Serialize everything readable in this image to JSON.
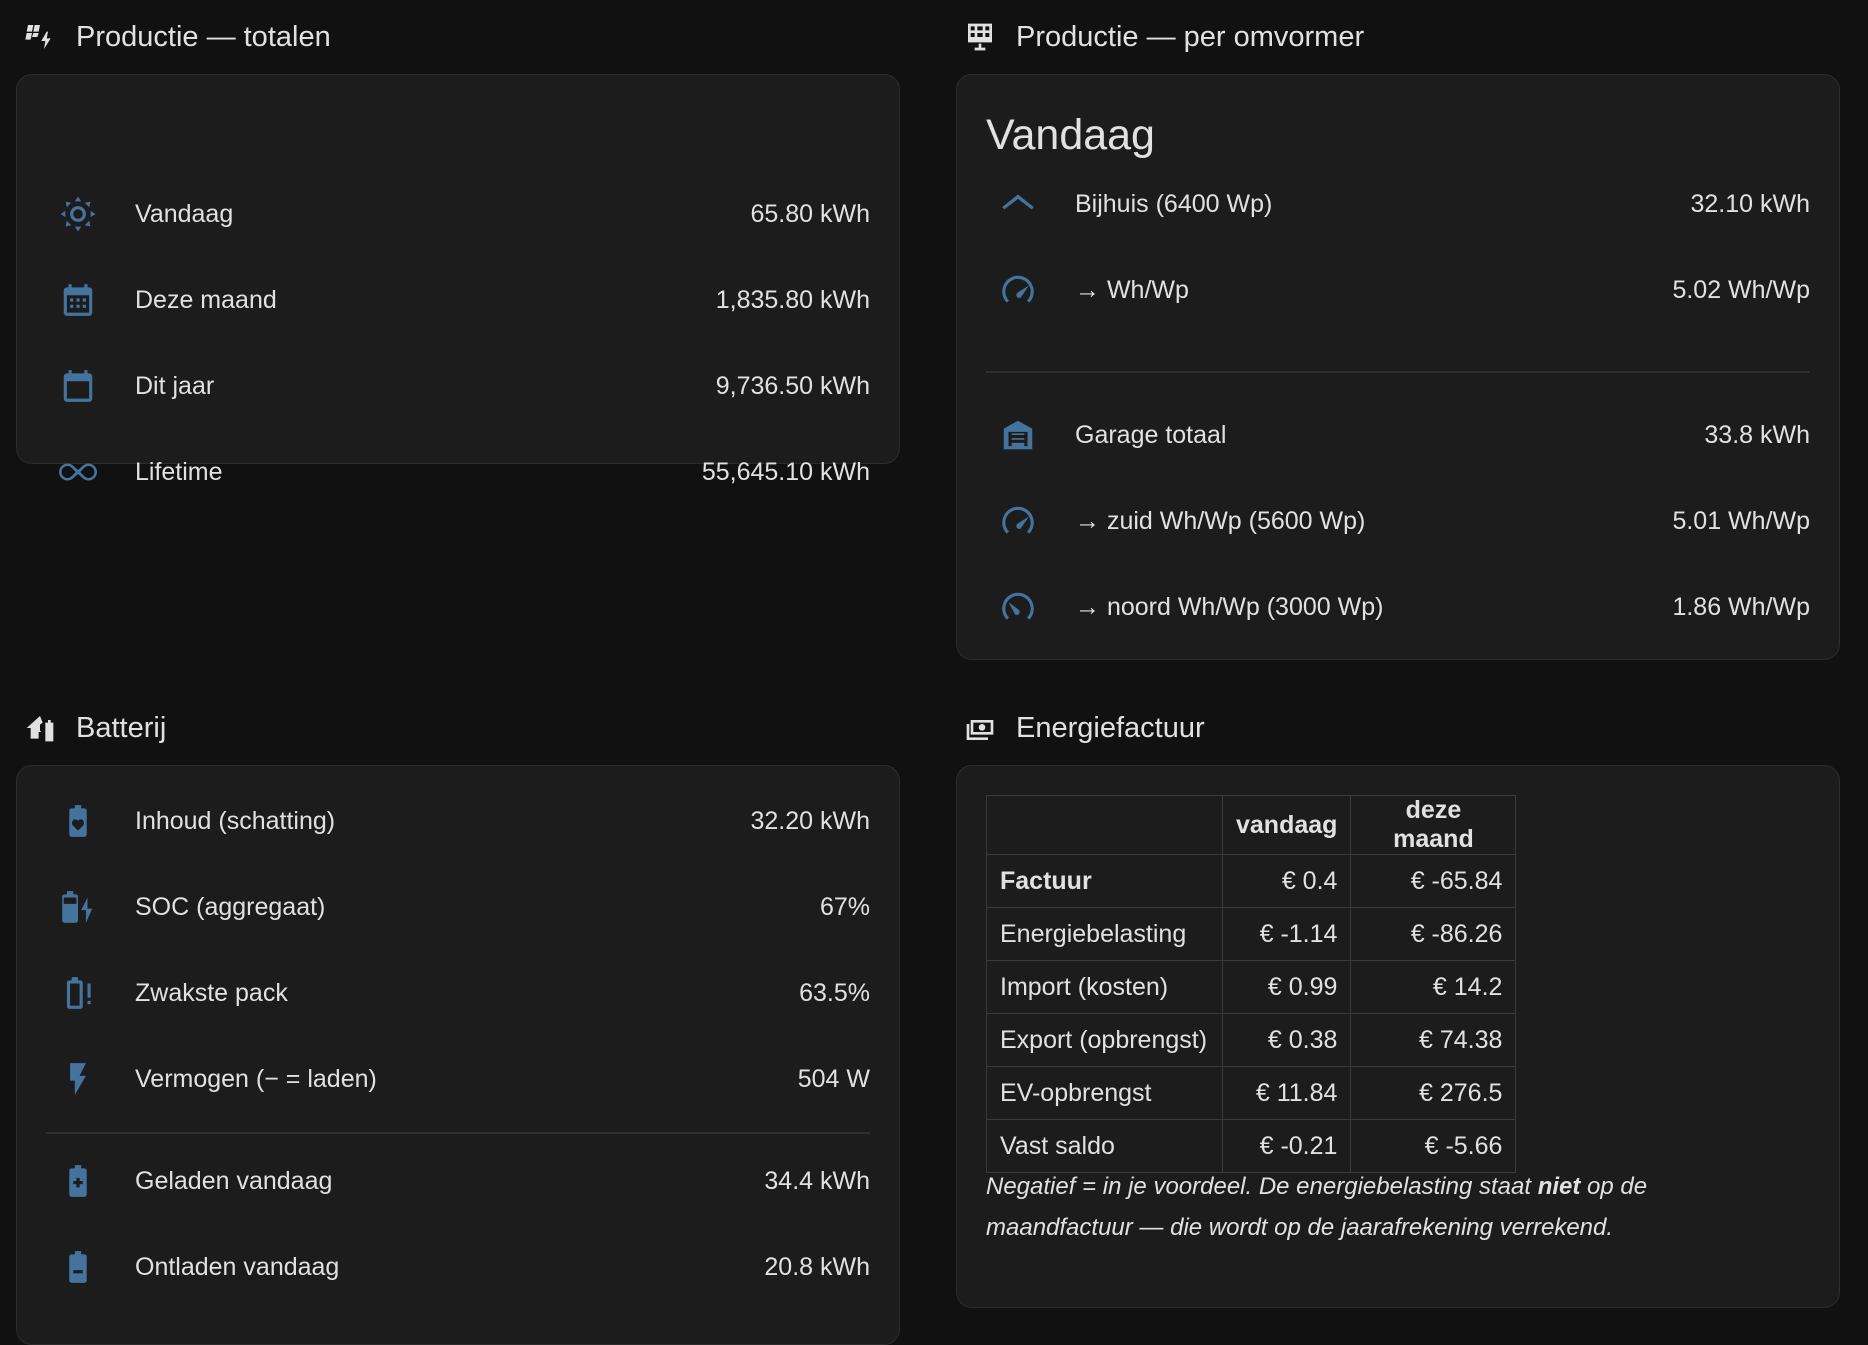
{
  "colors": {
    "background": "#111111",
    "card": "#1c1c1c",
    "icon": "#44739e",
    "text": "#e1e1e1"
  },
  "totals": {
    "title": "Productie — totalen",
    "title_icon": "solar-power-icon",
    "rows": [
      {
        "icon": "sun-icon",
        "label": "Vandaag",
        "value": "65.80 kWh"
      },
      {
        "icon": "calendar-month-icon",
        "label": "Deze maand",
        "value": "1,835.80 kWh"
      },
      {
        "icon": "calendar-blank-icon",
        "label": "Dit jaar",
        "value": "9,736.50 kWh"
      },
      {
        "icon": "infinity-icon",
        "label": "Lifetime",
        "value": "55,645.10 kWh"
      }
    ]
  },
  "inverter": {
    "title": "Productie — per omvormer",
    "title_icon": "solar-panel-icon",
    "card_title": "Vandaag",
    "rows": [
      {
        "icon": "roof-icon",
        "label": "Bijhuis (6400 Wp)",
        "value": "32.10 kWh"
      },
      {
        "icon": "gauge-icon",
        "label": "→ Wh/Wp",
        "value": "5.02 Wh/Wp"
      },
      {
        "icon": "garage-icon",
        "label": "Garage totaal",
        "value": "33.8 kWh"
      },
      {
        "icon": "gauge-icon",
        "label": "→ zuid Wh/Wp (5600 Wp)",
        "value": "5.01 Wh/Wp"
      },
      {
        "icon": "gauge-low-icon",
        "label": "→ noord Wh/Wp (3000 Wp)",
        "value": "1.86 Wh/Wp"
      }
    ]
  },
  "battery": {
    "title": "Batterij",
    "title_icon": "home-battery-icon",
    "rows": [
      {
        "icon": "battery-heart-icon",
        "label": "Inhoud (schatting)",
        "value": "32.20 kWh"
      },
      {
        "icon": "battery-charging-icon",
        "label": "SOC (aggregaat)",
        "value": "67%"
      },
      {
        "icon": "battery-alert-icon",
        "label": "Zwakste pack",
        "value": "63.5%"
      },
      {
        "icon": "lightning-icon",
        "label": "Vermogen (− = laden)",
        "value": "504 W"
      },
      {
        "icon": "battery-plus-icon",
        "label": "Geladen vandaag",
        "value": "34.4 kWh"
      },
      {
        "icon": "battery-minus-icon",
        "label": "Ontladen vandaag",
        "value": "20.8 kWh"
      }
    ]
  },
  "bill": {
    "title": "Energiefactuur",
    "title_icon": "cash-icon",
    "headers": [
      "",
      "vandaag",
      "deze maand"
    ],
    "rows": [
      {
        "label": "Factuur",
        "today": "€ 0.4",
        "month": "€ -65.84",
        "bold": true
      },
      {
        "label": "Energiebelasting",
        "today": "€ -1.14",
        "month": "€ -86.26"
      },
      {
        "label": "Import (kosten)",
        "today": "€ 0.99",
        "month": "€ 14.2"
      },
      {
        "label": "Export (opbrengst)",
        "today": "€ 0.38",
        "month": "€ 74.38"
      },
      {
        "label": "EV-opbrengst",
        "today": "€ 11.84",
        "month": "€ 276.5"
      },
      {
        "label": "Vast saldo",
        "today": "€ -0.21",
        "month": "€ -5.66"
      }
    ],
    "note_part1": "Negatief = in je voordeel. De energiebelasting staat ",
    "note_bold": "niet",
    "note_part2": " op de maandfactuur — die wordt op de jaarafrekening verrekend."
  }
}
